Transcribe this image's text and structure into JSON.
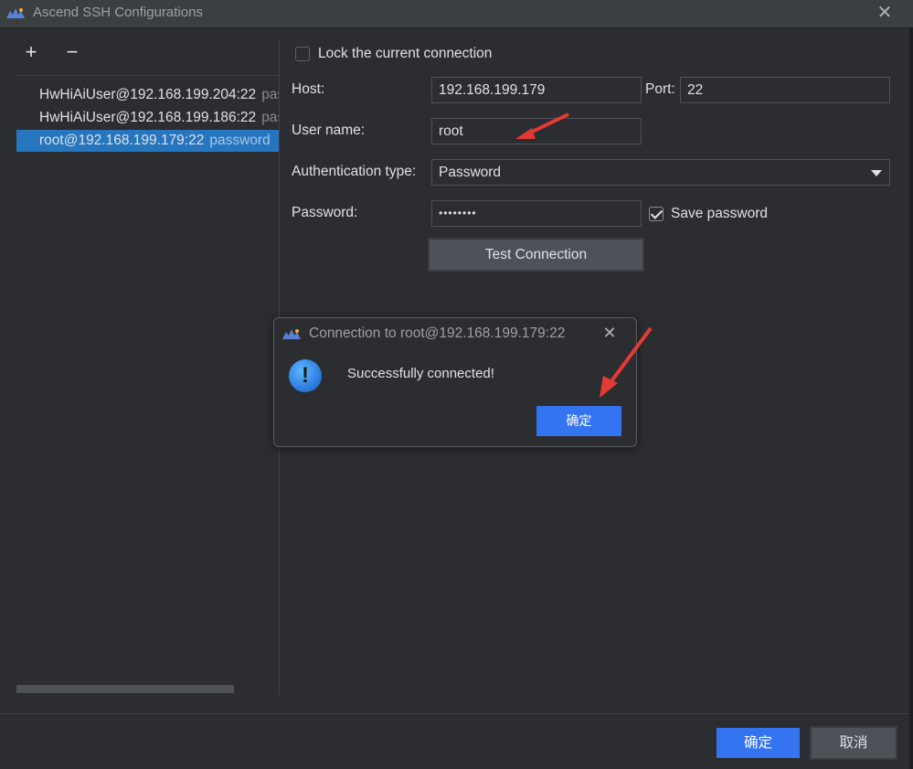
{
  "window": {
    "title": "Ascend SSH Configurations"
  },
  "toolbar": {
    "add_label": "+",
    "remove_label": "−"
  },
  "connections": [
    {
      "host": "HwHiAiUser@192.168.199.204:22",
      "auth": "password"
    },
    {
      "host": "HwHiAiUser@192.168.199.186:22",
      "auth": "password"
    },
    {
      "host": "root@192.168.199.179:22",
      "auth": "password",
      "selected": true
    }
  ],
  "form": {
    "lock_label": "Lock the current connection",
    "lock_checked": false,
    "host_label": "Host:",
    "host_value": "192.168.199.179",
    "port_label": "Port:",
    "port_value": "22",
    "username_label": "User name:",
    "username_value": "root",
    "auth_label": "Authentication type:",
    "auth_value": "Password",
    "password_label": "Password:",
    "password_value": "••••••••",
    "save_password_label": "Save password",
    "save_password_checked": true,
    "test_button": "Test Connection"
  },
  "dialog": {
    "title": "Connection to root@192.168.199.179:22",
    "message": "Successfully connected!",
    "ok_button": "确定"
  },
  "footer": {
    "ok_button": "确定",
    "cancel_button": "取消"
  },
  "colors": {
    "accent": "#3574f0",
    "selection": "#2675bf",
    "annotation_arrow": "#e53935"
  },
  "icons": [
    "app-logo-icon",
    "close-icon",
    "add-icon",
    "remove-icon",
    "dropdown-arrow-icon",
    "info-icon",
    "check-icon"
  ]
}
